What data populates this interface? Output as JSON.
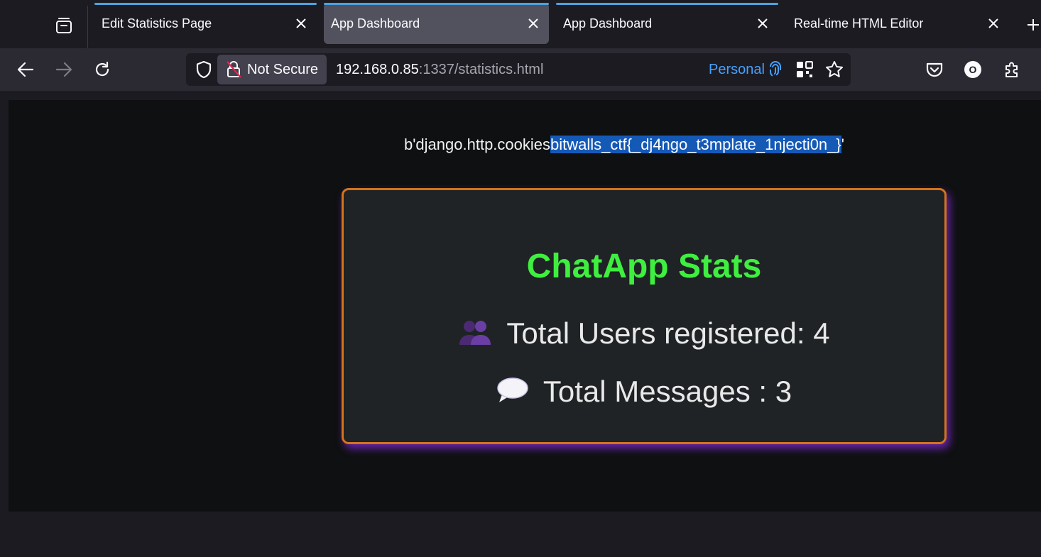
{
  "browser": {
    "tabs": [
      {
        "label": "Edit Statistics Page",
        "active": false
      },
      {
        "label": "App Dashboard",
        "active": true
      },
      {
        "label": "App Dashboard",
        "active": false
      },
      {
        "label": "Real-time HTML Editor",
        "active": false
      }
    ],
    "security_label": "Not Secure",
    "url_host": "192.168.0.85",
    "url_rest": ":1337/statistics.html",
    "container_label": "Personal",
    "account_initial": "O",
    "accent_color": "#45a1ff"
  },
  "page": {
    "leak_prefix": "b'django.http.cookies",
    "leak_selected": "bitwalls_ctf{_dj4ngo_t3mplate_1njecti0n_}",
    "leak_suffix": "'",
    "card": {
      "title": "ChatApp Stats",
      "users_text": "Total Users registered: 4",
      "messages_text": "Total Messages : 3",
      "title_color": "#3fef3f",
      "border_color": "#d4731c"
    }
  }
}
